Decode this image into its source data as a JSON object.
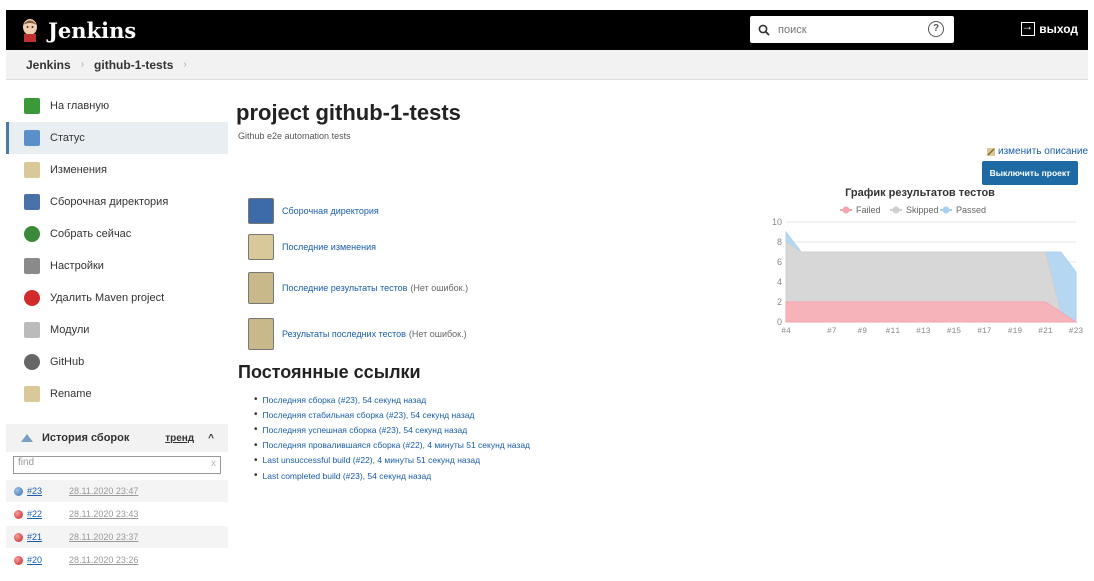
{
  "header": {
    "logo": "Jenkins",
    "search_placeholder": "поиск",
    "help": "?",
    "logout": "выход"
  },
  "breadcrumb": {
    "root": "Jenkins",
    "project": "github-1-tests",
    "sep": "›"
  },
  "sidebar": {
    "items": [
      {
        "label": "На главную",
        "icon": "home-arrow-icon",
        "color": "#3a9a3a"
      },
      {
        "label": "Статус",
        "icon": "magnifier-icon",
        "color": "#5b8fc9"
      },
      {
        "label": "Изменения",
        "icon": "notepad-icon",
        "color": "#d8c89a"
      },
      {
        "label": "Сборочная директория",
        "icon": "folder-icon",
        "color": "#4a72a8"
      },
      {
        "label": "Собрать сейчас",
        "icon": "clock-play-icon",
        "color": "#3b8a3b"
      },
      {
        "label": "Настройки",
        "icon": "gear-icon",
        "color": "#8a8a8a"
      },
      {
        "label": "Удалить Maven project",
        "icon": "no-entry-icon",
        "color": "#d12b2b"
      },
      {
        "label": "Модули",
        "icon": "modules-icon",
        "color": "#bbbbbb"
      },
      {
        "label": "GitHub",
        "icon": "github-icon",
        "color": "#666666"
      },
      {
        "label": "Rename",
        "icon": "pencil-icon",
        "color": "#d8c89a"
      }
    ]
  },
  "history": {
    "title": "История сборок",
    "trend": "тренд",
    "trend_arrow": "^",
    "find_placeholder": "find",
    "find_clear": "x",
    "builds": [
      {
        "num": "#23",
        "date": "28.11.2020 23:47",
        "status": "blue"
      },
      {
        "num": "#22",
        "date": "28.11.2020 23:43",
        "status": "red"
      },
      {
        "num": "#21",
        "date": "28.11.2020 23:37",
        "status": "red"
      },
      {
        "num": "#20",
        "date": "28.11.2020 23:26",
        "status": "red"
      }
    ]
  },
  "main": {
    "title": "project github-1-tests",
    "description": "Github e2e automation tests",
    "edit_description": "изменить описание",
    "disable_button": "Выключить проект",
    "links": [
      {
        "label": "Сборочная директория",
        "extra": "",
        "icon": "folder-icon"
      },
      {
        "label": "Последние изменения",
        "extra": "",
        "icon": "notepad-icon"
      },
      {
        "label": "Последние результаты тестов",
        "extra": "(Нет ошибок.)",
        "icon": "clipboard-icon"
      },
      {
        "label": "Результаты последних тестов",
        "extra": "(Нет ошибок.)",
        "icon": "clipboard-icon"
      }
    ],
    "permalinks_title": "Постоянные ссылки",
    "permalinks": [
      "Последняя сборка (#23), 54 секунд назад",
      "Последняя стабильная сборка (#23), 54 секунд назад",
      "Последняя успешная сборка (#23), 54 секунд назад",
      "Последняя провалившаяся сборка (#22), 4 минуты 51 секунд назад",
      "Last unsuccessful build (#22), 4 минуты 51 секунд назад",
      "Last completed build (#23), 54 секунд назад"
    ]
  },
  "chart_data": {
    "type": "area",
    "title": "График результатов тестов",
    "legend_position": "top",
    "x": [
      "#4",
      "#5",
      "#6",
      "#7",
      "#8",
      "#9",
      "#10",
      "#11",
      "#12",
      "#13",
      "#14",
      "#15",
      "#16",
      "#17",
      "#18",
      "#19",
      "#20",
      "#21",
      "#22",
      "#23"
    ],
    "xticks": [
      "#4",
      "#7",
      "#9",
      "#11",
      "#13",
      "#15",
      "#17",
      "#19",
      "#21",
      "#23"
    ],
    "ylim": [
      0,
      10
    ],
    "yticks": [
      "0",
      "2",
      "4",
      "6",
      "8",
      "10"
    ],
    "grid": true,
    "stacked": true,
    "series": [
      {
        "name": "Failed",
        "color": "#f4a6ae",
        "values": [
          2,
          2,
          2,
          2,
          2,
          2,
          2,
          2,
          2,
          2,
          2,
          2,
          2,
          2,
          2,
          2,
          2,
          2,
          1,
          0
        ]
      },
      {
        "name": "Skipped",
        "color": "#d0d0d0",
        "values": [
          6,
          5,
          5,
          5,
          5,
          5,
          5,
          5,
          5,
          5,
          5,
          5,
          5,
          5,
          5,
          5,
          5,
          5,
          0,
          0
        ]
      },
      {
        "name": "Passed",
        "color": "#a8d0f0",
        "values": [
          1,
          0,
          0,
          0,
          0,
          0,
          0,
          0,
          0,
          0,
          0,
          0,
          0,
          0,
          0,
          0,
          0,
          0,
          6,
          5
        ]
      }
    ]
  }
}
